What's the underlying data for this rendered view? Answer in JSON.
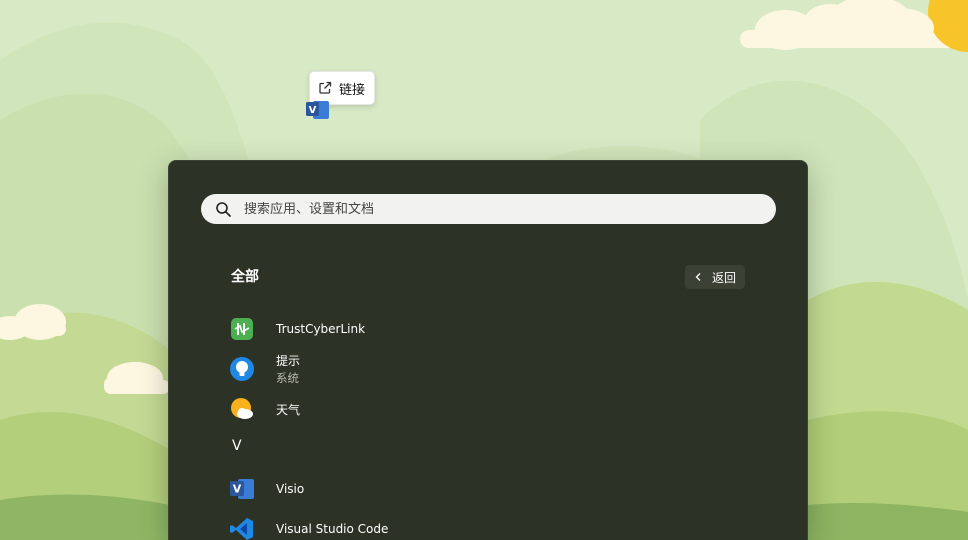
{
  "drag_tooltip": {
    "label": "链接",
    "icon": "external-link-icon",
    "dragged_app_icon": "visio-icon"
  },
  "start_menu": {
    "search": {
      "placeholder": "搜索应用、设置和文档",
      "icon": "search-icon"
    },
    "section_title": "全部",
    "back_button": {
      "label": "返回",
      "icon": "chevron-left-icon"
    },
    "apps": [
      {
        "name": "TrustCyberLink",
        "subtitle": "",
        "icon": "trustcyberlink-icon"
      },
      {
        "name": "提示",
        "subtitle": "系统",
        "icon": "tips-lightbulb-icon"
      },
      {
        "name": "天气",
        "subtitle": "",
        "icon": "weather-icon"
      },
      {
        "name": "Visio",
        "subtitle": "",
        "icon": "visio-icon"
      },
      {
        "name": "Visual Studio Code",
        "subtitle": "",
        "icon": "vscode-icon"
      }
    ],
    "letter_header": "V"
  },
  "colors": {
    "panel_bg": "#2d3226",
    "search_bg": "#f2f2f0",
    "wallpaper_sky": "#d6e9c3",
    "accent_green": "#4caf50",
    "visio_blue": "#2b579a"
  }
}
